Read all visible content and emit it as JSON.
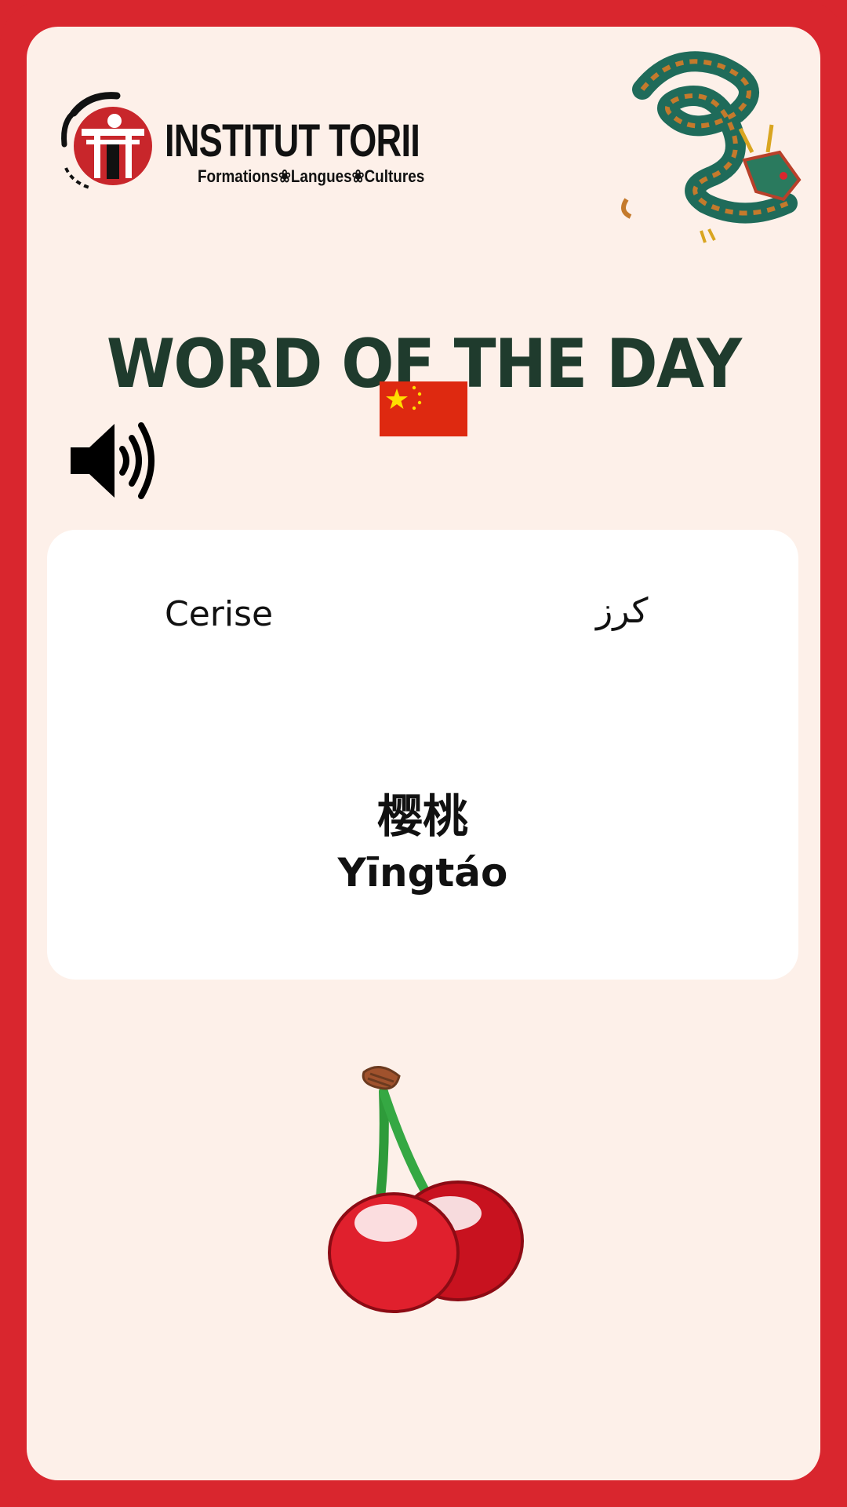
{
  "brand": {
    "name": "INSTITUT TORII",
    "tagline": "Formations❀Langues❀Cultures",
    "emblem_glyphs": "道 鳥居"
  },
  "title": "WORD OF THE DAY",
  "flag": {
    "icon": "china-flag-icon",
    "colors": {
      "red": "#de2910",
      "gold": "#ffde00"
    }
  },
  "audio": {
    "icon": "speaker-icon"
  },
  "word": {
    "french": "Cerise",
    "arabic": "كرز",
    "chinese": "樱桃",
    "pinyin": "Yīngtáo"
  },
  "illustration": {
    "icon": "cherry-icon"
  },
  "colors": {
    "frame": "#d9262e",
    "card": "#fdf0e9",
    "panel": "#ffffff",
    "title": "#1f3b2d"
  }
}
